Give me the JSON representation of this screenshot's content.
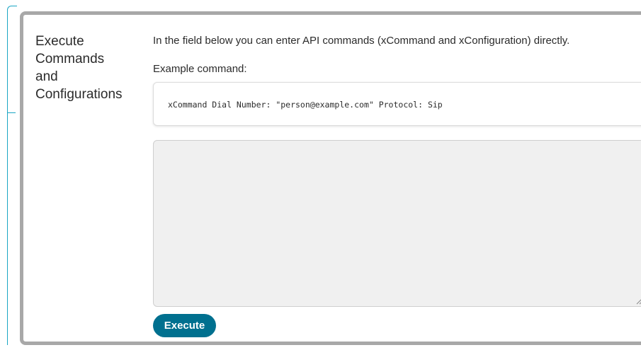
{
  "section": {
    "title": "Execute\nCommands\nand\nConfigurations"
  },
  "intro": {
    "text": "In the field below you can enter API commands (xCommand and xConfiguration) directly."
  },
  "example": {
    "label": "Example command:",
    "code": "xCommand Dial Number: \"person@example.com\" Protocol: Sip"
  },
  "command_input": {
    "value": "",
    "placeholder": ""
  },
  "actions": {
    "execute_label": "Execute"
  },
  "colors": {
    "accent": "#00708f",
    "bracket": "#1ba6c4",
    "card_border": "#a8a8a8",
    "input_bg": "#f0f0f0"
  }
}
